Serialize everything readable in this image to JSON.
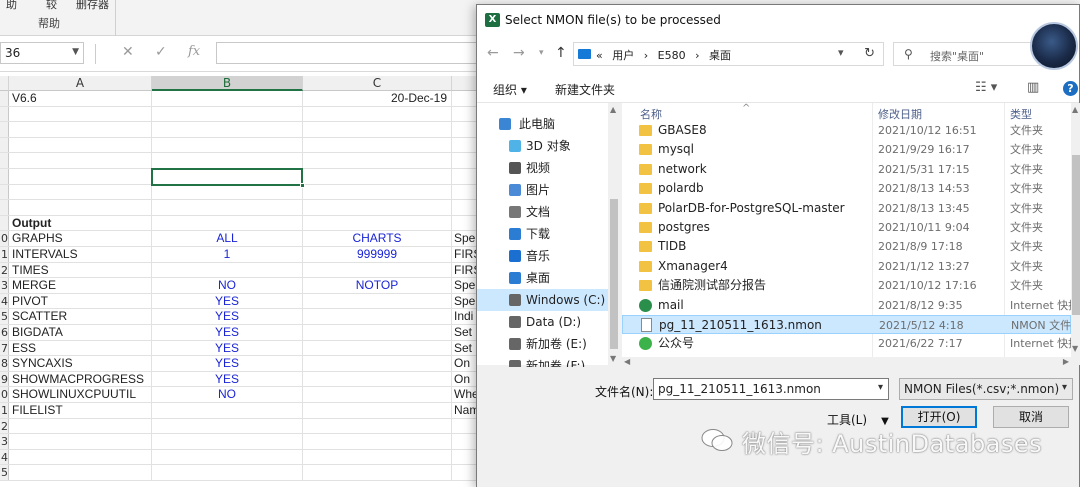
{
  "excel": {
    "ribbon": {
      "items": [
        "助",
        "较",
        "删存器"
      ],
      "group_label": "帮助"
    },
    "name_box": "36",
    "formula_icons": {
      "cancel": "✕",
      "enter": "✓",
      "fx": "fx"
    },
    "columns": [
      "A",
      "B",
      "C"
    ],
    "rows": [
      {
        "num": "",
        "a": "V6.6",
        "b": "",
        "c": "20-Dec-19",
        "d": ""
      },
      {
        "num": "",
        "a": "",
        "b": "",
        "c": "",
        "d": ""
      },
      {
        "num": "",
        "a": "",
        "b": "",
        "c": "",
        "d": ""
      },
      {
        "num": "",
        "a": "",
        "b": "",
        "c": "",
        "d": ""
      },
      {
        "num": "",
        "a": "",
        "b": "",
        "c": "",
        "d": ""
      },
      {
        "num": "",
        "a": "",
        "b": "",
        "c": "",
        "d": ""
      },
      {
        "num": "",
        "a": "",
        "b": "",
        "c": "",
        "d": ""
      },
      {
        "num": "",
        "a": "",
        "b": "",
        "c": "",
        "d": ""
      },
      {
        "num": "",
        "a": "Output",
        "b": "",
        "c": "",
        "d": ""
      },
      {
        "num": "0",
        "a": "GRAPHS",
        "b": "ALL",
        "c": "CHARTS",
        "d": "Spe"
      },
      {
        "num": "1",
        "a": "INTERVALS",
        "b": "1",
        "c": "999999",
        "d": "FIRS"
      },
      {
        "num": "2",
        "a": "TIMES",
        "b": "",
        "c": "",
        "d": "FIRS"
      },
      {
        "num": "3",
        "a": "MERGE",
        "b": "NO",
        "c": "NOTOP",
        "d": "Spe"
      },
      {
        "num": "4",
        "a": "PIVOT",
        "b": "YES",
        "c": "",
        "d": "Spe"
      },
      {
        "num": "5",
        "a": "SCATTER",
        "b": "YES",
        "c": "",
        "d": "Indi"
      },
      {
        "num": "6",
        "a": "BIGDATA",
        "b": "YES",
        "c": "",
        "d": "Set"
      },
      {
        "num": "7",
        "a": "ESS",
        "b": "YES",
        "c": "",
        "d": "Set"
      },
      {
        "num": "8",
        "a": "SYNCAXIS",
        "b": "YES",
        "c": "",
        "d": "On"
      },
      {
        "num": "9",
        "a": "SHOWMACPROGRESS",
        "b": "YES",
        "c": "",
        "d": "On"
      },
      {
        "num": "0",
        "a": "SHOWLINUXCPUUTIL",
        "b": "NO",
        "c": "",
        "d": "Whe"
      },
      {
        "num": "1",
        "a": "FILELIST",
        "b": "",
        "c": "",
        "d": "Nam"
      },
      {
        "num": "2",
        "a": "",
        "b": "",
        "c": "",
        "d": ""
      },
      {
        "num": "3",
        "a": "",
        "b": "",
        "c": "",
        "d": ""
      },
      {
        "num": "4",
        "a": "",
        "b": "",
        "c": "",
        "d": ""
      },
      {
        "num": "5",
        "a": "",
        "b": "",
        "c": "",
        "d": ""
      }
    ]
  },
  "dialog": {
    "title": "Select NMON file(s) to be processed",
    "app_icon_label": "X",
    "breadcrumbs": [
      "«",
      "用户",
      "›",
      "E580",
      "›",
      "桌面"
    ],
    "search_placeholder": "搜索\"桌面\"",
    "toolbar": {
      "organize": "组织 ▾",
      "new_folder": "新建文件夹",
      "help": "?"
    },
    "nav": [
      {
        "label": "此电脑",
        "icon": "computer-icon",
        "color": "#3a86d4",
        "indent": 1
      },
      {
        "label": "3D 对象",
        "icon": "cube-icon",
        "color": "#4fb3e8",
        "indent": 2
      },
      {
        "label": "视频",
        "icon": "video-icon",
        "color": "#555",
        "indent": 2
      },
      {
        "label": "图片",
        "icon": "picture-icon",
        "color": "#4a8ad6",
        "indent": 2
      },
      {
        "label": "文档",
        "icon": "document-icon",
        "color": "#777",
        "indent": 2
      },
      {
        "label": "下载",
        "icon": "download-icon",
        "color": "#2b7cd3",
        "indent": 2
      },
      {
        "label": "音乐",
        "icon": "music-icon",
        "color": "#1a6fd0",
        "indent": 2
      },
      {
        "label": "桌面",
        "icon": "desktop-icon",
        "color": "#2b7cd3",
        "indent": 2
      },
      {
        "label": "Windows (C:)",
        "icon": "drive-icon",
        "color": "#666",
        "indent": 2,
        "selected": true
      },
      {
        "label": "Data (D:)",
        "icon": "drive-icon",
        "color": "#666",
        "indent": 2
      },
      {
        "label": "新加卷 (E:)",
        "icon": "drive-icon",
        "color": "#666",
        "indent": 2
      },
      {
        "label": "新加卷 (F:)",
        "icon": "drive-icon",
        "color": "#666",
        "indent": 2
      }
    ],
    "columns": {
      "name": "名称",
      "modified": "修改日期",
      "type": "类型"
    },
    "files": [
      {
        "name": "GBASE8",
        "date": "2021/10/12 16:51",
        "type": "文件夹",
        "kind": "folder"
      },
      {
        "name": "mysql",
        "date": "2021/9/29 16:17",
        "type": "文件夹",
        "kind": "folder"
      },
      {
        "name": "network",
        "date": "2021/5/31 17:15",
        "type": "文件夹",
        "kind": "folder"
      },
      {
        "name": "polardb",
        "date": "2021/8/13 14:53",
        "type": "文件夹",
        "kind": "folder"
      },
      {
        "name": "PolarDB-for-PostgreSQL-master",
        "date": "2021/8/13 13:45",
        "type": "文件夹",
        "kind": "folder"
      },
      {
        "name": "postgres",
        "date": "2021/10/11 9:04",
        "type": "文件夹",
        "kind": "folder"
      },
      {
        "name": "TIDB",
        "date": "2021/8/9 17:18",
        "type": "文件夹",
        "kind": "folder"
      },
      {
        "name": "Xmanager4",
        "date": "2021/1/12 13:27",
        "type": "文件夹",
        "kind": "folder"
      },
      {
        "name": "信通院测试部分报告",
        "date": "2021/10/12 17:16",
        "type": "文件夹",
        "kind": "folder"
      },
      {
        "name": "mail",
        "date": "2021/8/12 9:35",
        "type": "Internet 快捷",
        "kind": "link"
      },
      {
        "name": "pg_11_210511_1613.nmon",
        "date": "2021/5/12 4:18",
        "type": "NMON 文件",
        "kind": "file",
        "selected": true
      },
      {
        "name": "公众号",
        "date": "2021/6/22 7:17",
        "type": "Internet 快捷",
        "kind": "link2"
      }
    ],
    "filename_label": "文件名(N):",
    "filename_value": "pg_11_210511_1613.nmon",
    "filetype_value": "NMON Files(*.csv;*.nmon)",
    "tools_label": "工具(L)",
    "open_label": "打开(O)",
    "cancel_label": "取消"
  },
  "watermark": "微信号: AustinDatabases"
}
